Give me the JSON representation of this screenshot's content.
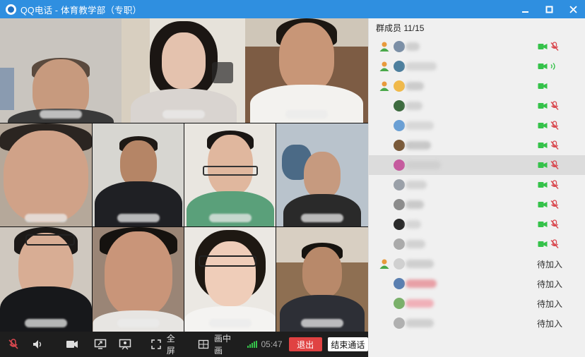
{
  "window": {
    "title": "QQ电话 - 体育教学部（专职）",
    "minimize_glyph": "▬",
    "maximize_glyph": "☐",
    "close_glyph": "✕"
  },
  "panel": {
    "header": "群成员 11/15"
  },
  "members": [
    {
      "role": "admin",
      "status": "muted",
      "status_text": ""
    },
    {
      "role": "admin",
      "status": "speaking",
      "status_text": ""
    },
    {
      "role": "admin",
      "status": "camera",
      "status_text": ""
    },
    {
      "role": "member",
      "status": "muted",
      "status_text": ""
    },
    {
      "role": "member",
      "status": "muted",
      "status_text": ""
    },
    {
      "role": "member",
      "status": "muted",
      "status_text": ""
    },
    {
      "role": "member",
      "status": "muted",
      "status_text": "",
      "selected": true
    },
    {
      "role": "member",
      "status": "muted",
      "status_text": ""
    },
    {
      "role": "member",
      "status": "muted",
      "status_text": ""
    },
    {
      "role": "member",
      "status": "muted",
      "status_text": ""
    },
    {
      "role": "member",
      "status": "muted",
      "status_text": ""
    },
    {
      "role": "admin",
      "status": "waiting",
      "status_text": "待加入"
    },
    {
      "role": "member",
      "status": "waiting",
      "status_text": "待加入"
    },
    {
      "role": "member",
      "status": "waiting",
      "status_text": "待加入"
    },
    {
      "role": "member",
      "status": "waiting",
      "status_text": "待加入"
    }
  ],
  "toolbar": {
    "fullscreen_label": "全屏",
    "pip_label": "画中画",
    "timer": "05:47",
    "exit_label": "退出",
    "end_call_label": "结束通话"
  },
  "icons": {
    "mic_muted": "mic-muted-icon",
    "speaker": "speaker-icon",
    "camera": "camera-icon",
    "screen_share": "screen-share-icon",
    "presentation": "presentation-icon",
    "fullscreen": "fullscreen-icon",
    "pip": "picture-in-picture-icon",
    "signal": "signal-strength-icon"
  },
  "colors": {
    "titlebar": "#2f8fe0",
    "accent_green": "#35c24a",
    "muted_red": "#d9484f",
    "exit_red": "#e04242"
  }
}
